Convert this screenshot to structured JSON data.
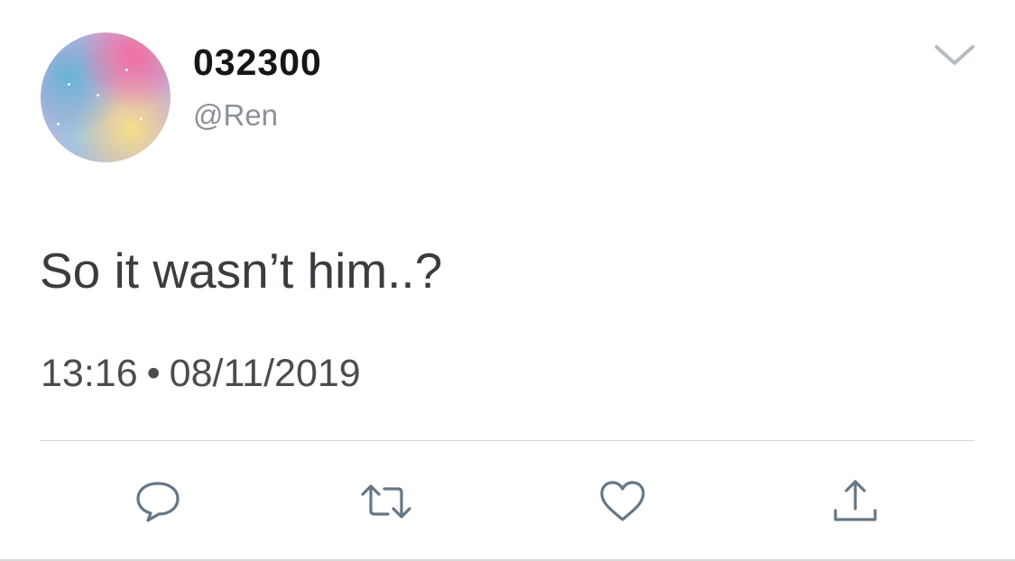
{
  "user": {
    "display_name": "032300",
    "handle": "@Ren"
  },
  "tweet": {
    "text": "So it wasn’t him..?",
    "time": "13:16",
    "separator": "•",
    "date": "08/11/2019"
  },
  "actions": {
    "icons": [
      "reply-icon",
      "retweet-icon",
      "like-icon",
      "share-icon"
    ]
  },
  "colors": {
    "text_primary": "#14171a",
    "text_secondary": "#8a9198",
    "icon": "#657786",
    "divider": "#d3d6d9"
  }
}
